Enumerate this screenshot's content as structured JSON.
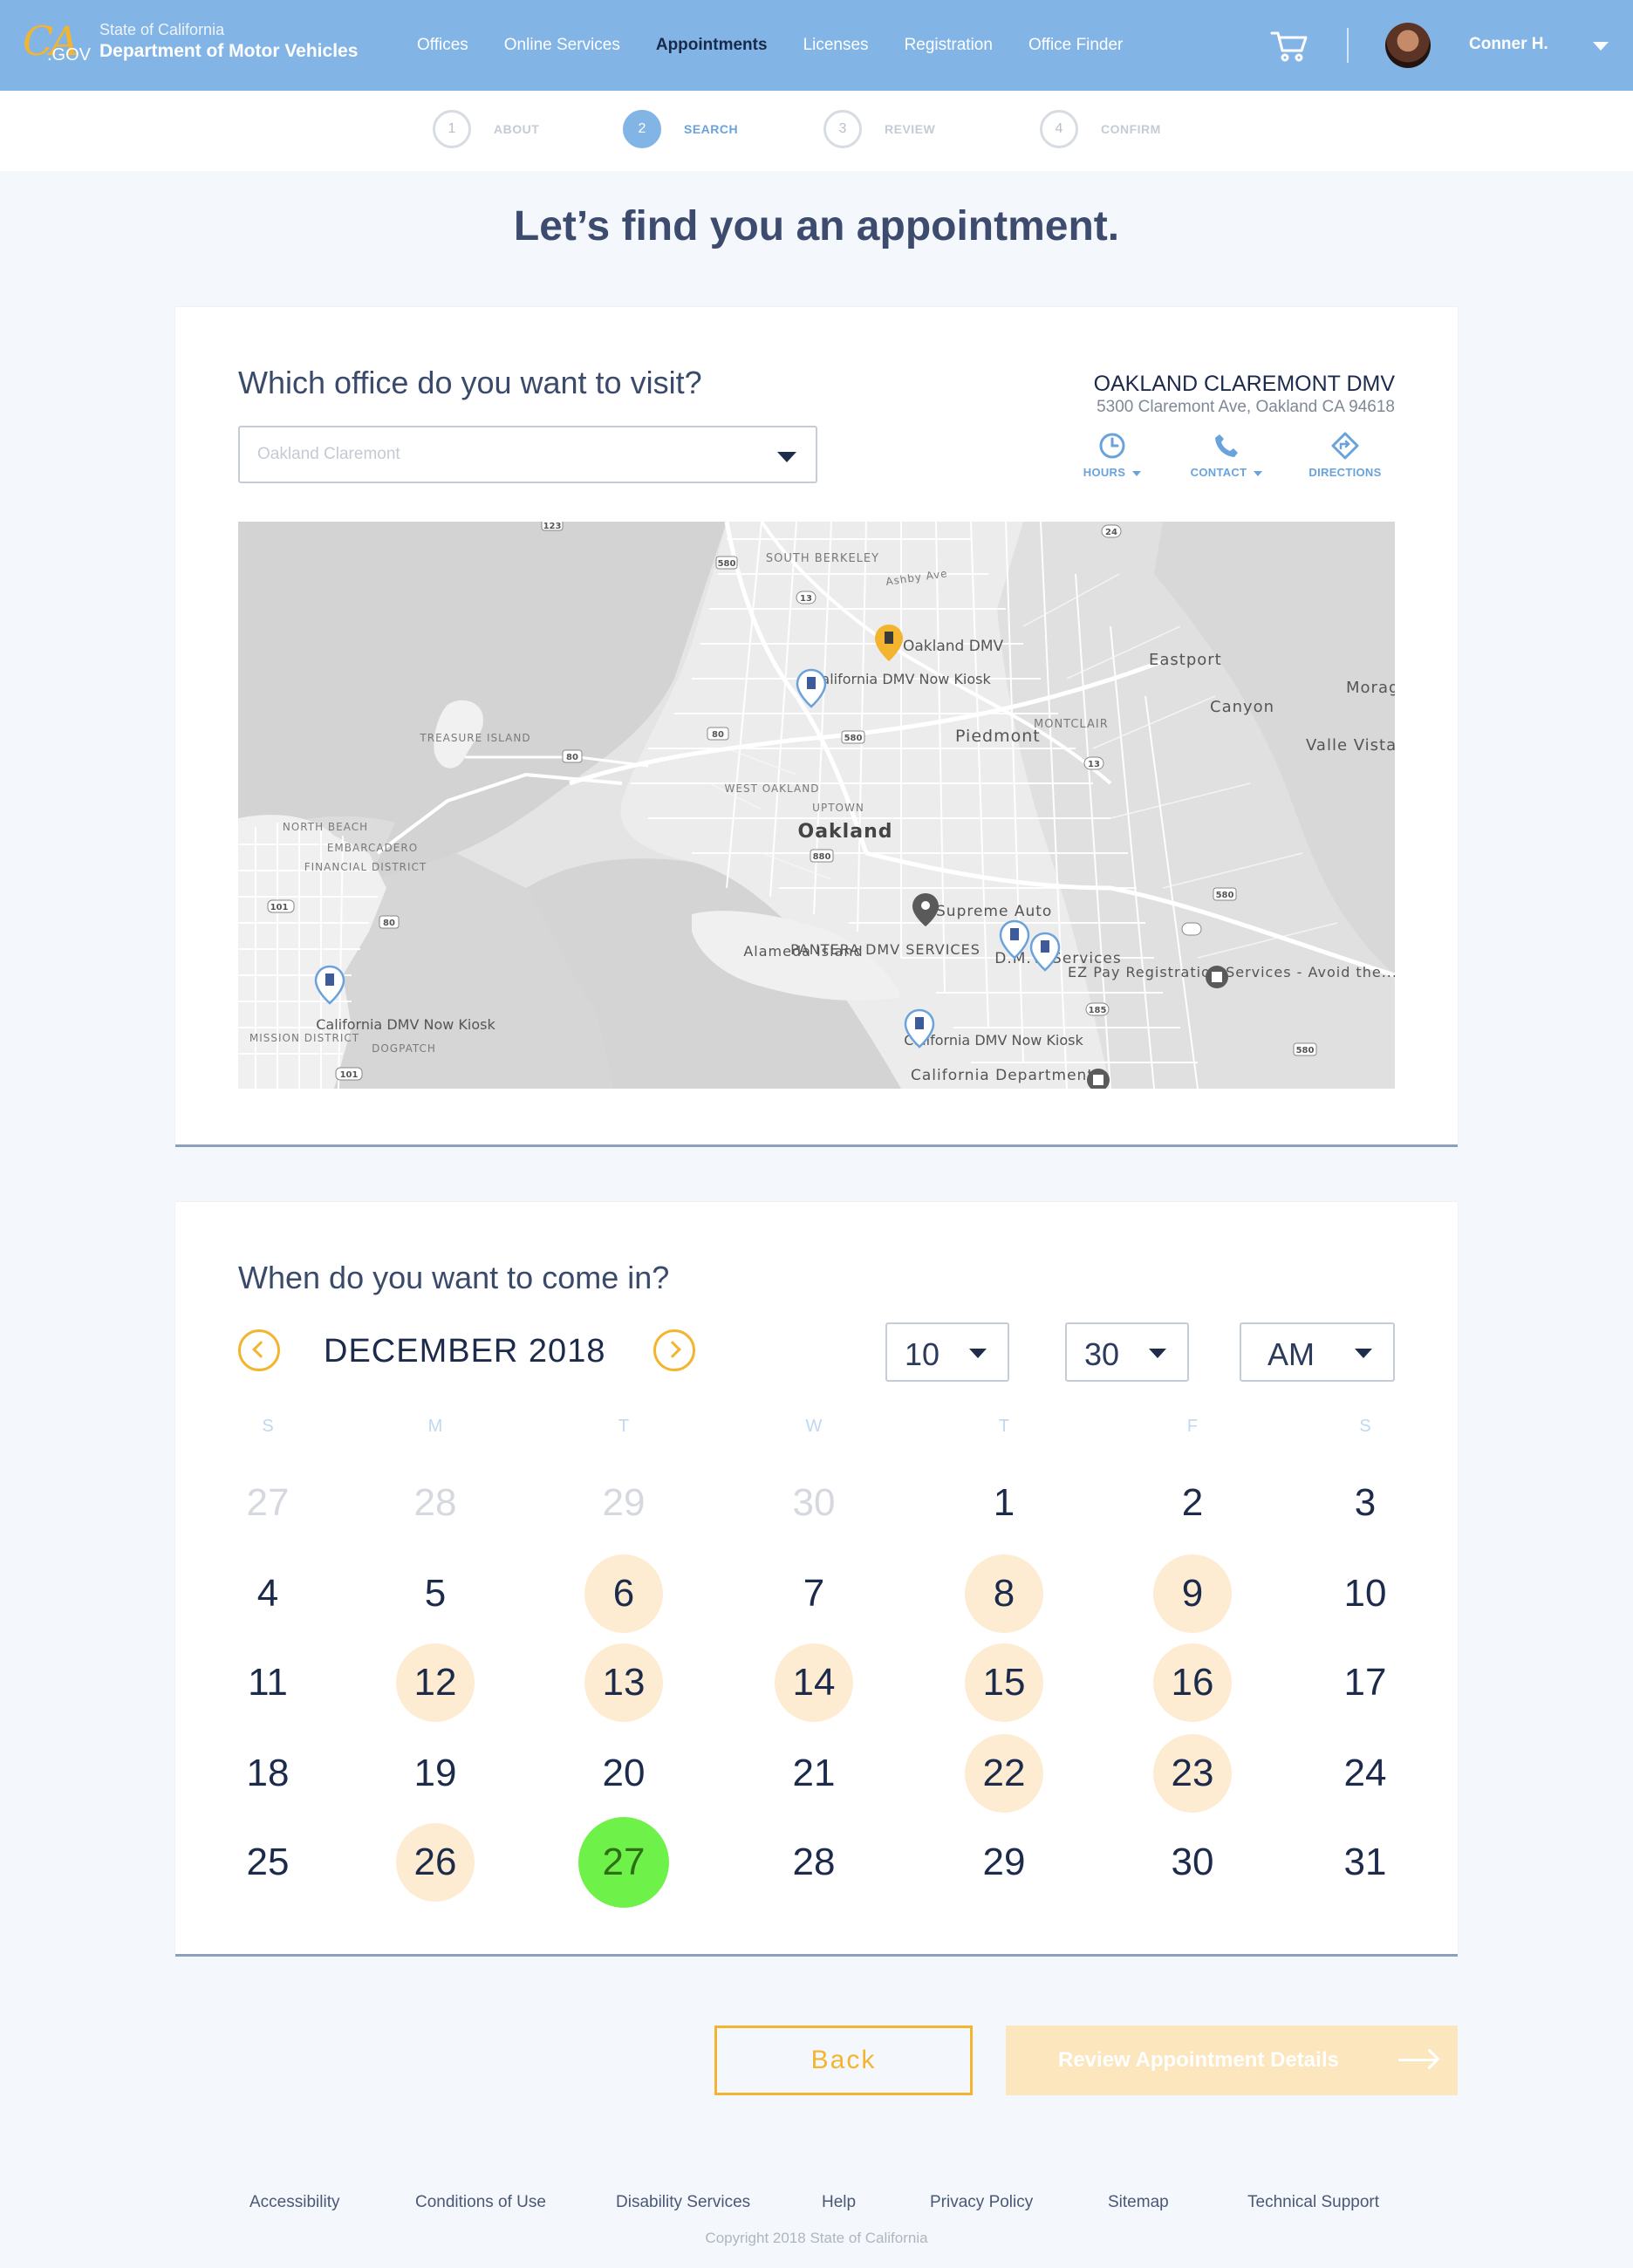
{
  "header": {
    "logo_ca": "CA",
    "logo_gov": ".GOV",
    "brand_line1": "State of California",
    "brand_line2": "Department of Motor Vehicles",
    "nav": [
      "Offices",
      "Online Services",
      "Appointments",
      "Licenses",
      "Registration",
      "Office Finder"
    ],
    "active_nav": "Appointments",
    "user_name": "Conner H."
  },
  "stepper": {
    "steps": [
      {
        "num": "1",
        "label": "ABOUT"
      },
      {
        "num": "2",
        "label": "SEARCH"
      },
      {
        "num": "3",
        "label": "REVIEW"
      },
      {
        "num": "4",
        "label": "CONFIRM"
      }
    ],
    "active_step": 2
  },
  "page_title": "Let’s find you an appointment.",
  "office": {
    "question": "Which office do you want to visit?",
    "select_value": "Oakland Claremont",
    "name": "OAKLAND CLAREMONT DMV",
    "address": "5300 Claremont Ave, Oakland CA 94618",
    "actions": [
      "HOURS",
      "CONTACT",
      "DIRECTIONS"
    ]
  },
  "map": {
    "places": [
      "SOUTH BERKELEY",
      "Ashby Ave",
      "Oakland DMV",
      "California DMV Now Kiosk",
      "Eastport",
      "Canyon",
      "Morag",
      "Valle Vista",
      "MONTCLAIR",
      "Piedmont",
      "TREASURE ISLAND",
      "WEST OAKLAND",
      "UPTOWN",
      "Oakland",
      "NORTH BEACH",
      "EMBARCADERO",
      "FINANCIAL DISTRICT",
      "Supreme Auto",
      "Alameda Island",
      "PANTERA DMV SERVICES",
      "D.M.V. Services",
      "EZ Pay Registration Services - Avoid the...",
      "California DMV Now Kiosk",
      "California DMV Now Kiosk",
      "MISSION DISTRICT",
      "DOGPATCH",
      "California Department"
    ],
    "highways": [
      "123",
      "580",
      "13",
      "24",
      "80",
      "80",
      "580",
      "880",
      "101",
      "80",
      "580",
      "13",
      "185",
      "580",
      "101"
    ]
  },
  "schedule": {
    "question": "When do you want to come in?",
    "month": "DECEMBER 2018",
    "hour": "10",
    "minute": "30",
    "ampm": "AM",
    "weekdays": [
      "S",
      "M",
      "T",
      "W",
      "T",
      "F",
      "S"
    ],
    "weeks": [
      [
        "27",
        "28",
        "29",
        "30",
        "1",
        "2",
        "3"
      ],
      [
        "4",
        "5",
        "6",
        "7",
        "8",
        "9",
        "10"
      ],
      [
        "11",
        "12",
        "13",
        "14",
        "15",
        "16",
        "17"
      ],
      [
        "18",
        "19",
        "20",
        "21",
        "22",
        "23",
        "24"
      ],
      [
        "25",
        "26",
        "27",
        "28",
        "29",
        "30",
        "31"
      ]
    ],
    "previous_month_days": [
      "27",
      "28",
      "29",
      "30"
    ],
    "available_days": [
      "6",
      "8",
      "9",
      "12",
      "13",
      "14",
      "15",
      "16",
      "22",
      "23",
      "26"
    ],
    "selected_day": "27"
  },
  "buttons": {
    "back": "Back",
    "next": "Review Appointment Details"
  },
  "footer": {
    "links": [
      "Accessibility",
      "Conditions of Use",
      "Disability Services",
      "Help",
      "Privacy Policy",
      "Sitemap",
      "Technical Support"
    ],
    "copyright": "Copyright 2018 State of California"
  },
  "colors": {
    "header_bg": "#82b4e6",
    "accent": "#f3b52f",
    "available_day": "#fdecd1",
    "selected_day": "#6ef24a",
    "link_blue": "#6aa2dc"
  }
}
